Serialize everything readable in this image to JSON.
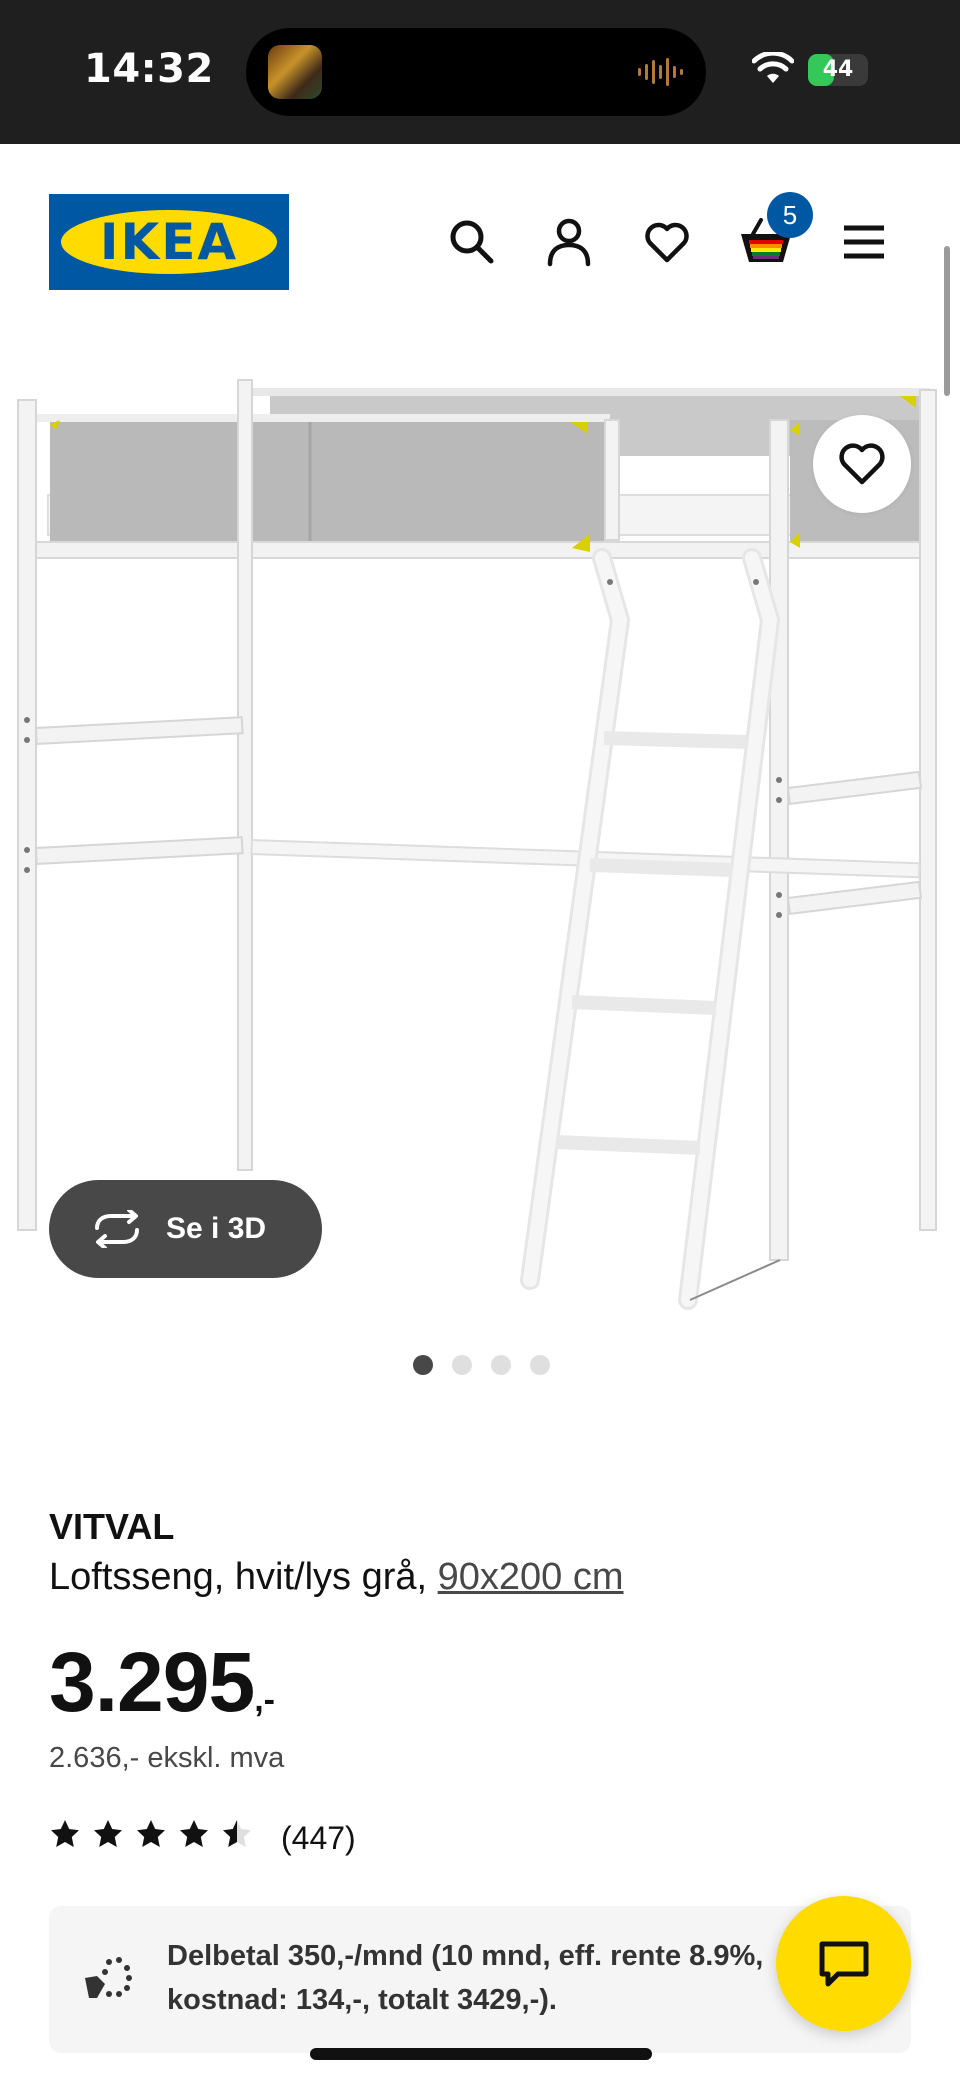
{
  "status_bar": {
    "time": "14:32",
    "battery": "44",
    "battery_level_percent": 44
  },
  "header": {
    "logo_text": "IKEA",
    "cart_count": "5",
    "icons": [
      "search-icon",
      "account-icon",
      "heart-icon",
      "basket-icon",
      "menu-icon"
    ]
  },
  "gallery": {
    "view_3d_label": "Se i 3D",
    "image_count": 4,
    "active_index": 0
  },
  "product": {
    "name": "VITVAL",
    "description_prefix": "Loftsseng, hvit/lys grå,",
    "size": "90x200 cm",
    "price_main": "3.295",
    "price_suffix": ",-",
    "price_excl_vat": "2.636,- ekskl. mva",
    "rating": 4.5,
    "review_count": "(447)"
  },
  "finance": {
    "text": "Delbetal 350,-/mnd (10 mnd, eff. rente 8.9%, kostnad: 134,-, totalt 3429,-)."
  },
  "colors": {
    "ikea_blue": "#0058a3",
    "ikea_yellow": "#ffdb00",
    "dark_grey": "#484848"
  }
}
